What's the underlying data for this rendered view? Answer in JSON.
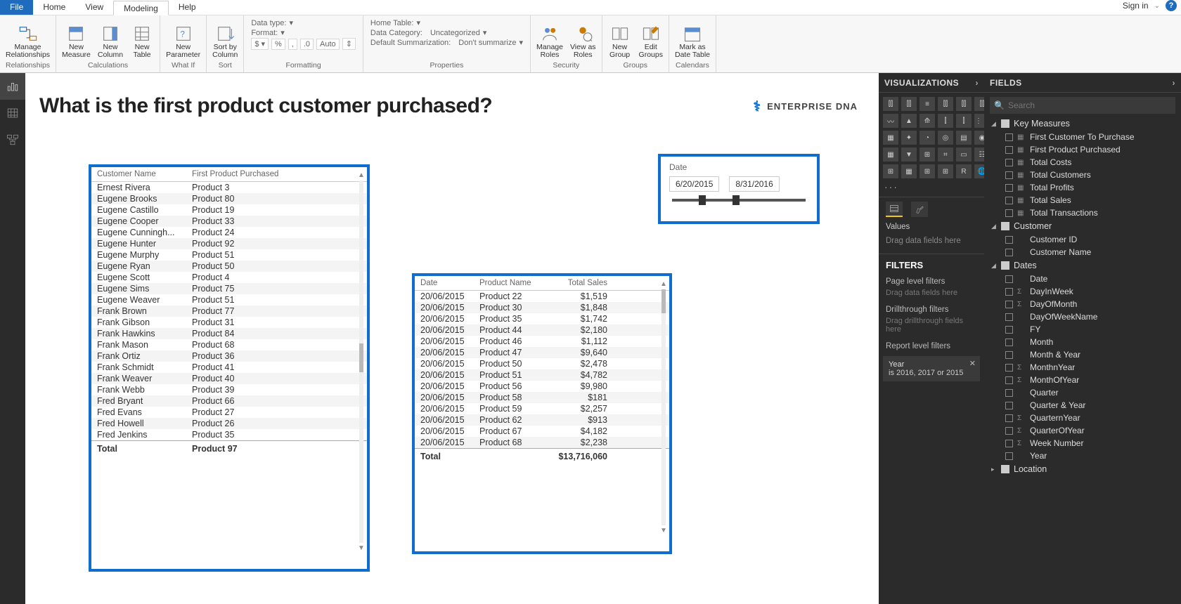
{
  "menu": {
    "file": "File",
    "home": "Home",
    "view": "View",
    "modeling": "Modeling",
    "help": "Help",
    "signin": "Sign in"
  },
  "ribbon": {
    "manageRel": "Manage\nRelationships",
    "relTitle": "Relationships",
    "newMeasure": "New\nMeasure",
    "newColumn": "New\nColumn",
    "newTable": "New\nTable",
    "calcTitle": "Calculations",
    "newParam": "New\nParameter",
    "whatIfTitle": "What If",
    "sort": "Sort by\nColumn",
    "sortTitle": "Sort",
    "dataType": "Data type:",
    "format": "Format:",
    "auto": "Auto",
    "fmtTitle": "Formatting",
    "homeTable": "Home Table:",
    "dataCat": "Data Category:",
    "dataCatVal": "Uncategorized",
    "defSum": "Default Summarization:",
    "defSumVal": "Don't summarize",
    "propsTitle": "Properties",
    "manageRoles": "Manage\nRoles",
    "viewAs": "View as\nRoles",
    "secTitle": "Security",
    "newGroup": "New\nGroup",
    "editGroups": "Edit\nGroups",
    "grpTitle": "Groups",
    "markDate": "Mark as\nDate Table",
    "calTitle": "Calendars"
  },
  "canvas": {
    "title": "What is the first product customer purchased?",
    "brand": "ENTERPRISE DNA"
  },
  "slicer": {
    "label": "Date",
    "from": "6/20/2015",
    "to": "8/31/2016"
  },
  "table1": {
    "h1": "Customer Name",
    "h2": "First Product Purchased",
    "rows": [
      [
        "Ernest Rivera",
        "Product 3"
      ],
      [
        "Eugene Brooks",
        "Product 80"
      ],
      [
        "Eugene Castillo",
        "Product 19"
      ],
      [
        "Eugene Cooper",
        "Product 33"
      ],
      [
        "Eugene Cunningh...",
        "Product 24"
      ],
      [
        "Eugene Hunter",
        "Product 92"
      ],
      [
        "Eugene Murphy",
        "Product 51"
      ],
      [
        "Eugene Ryan",
        "Product 50"
      ],
      [
        "Eugene Scott",
        "Product 4"
      ],
      [
        "Eugene Sims",
        "Product 75"
      ],
      [
        "Eugene Weaver",
        "Product 51"
      ],
      [
        "Frank Brown",
        "Product 77"
      ],
      [
        "Frank Gibson",
        "Product 31"
      ],
      [
        "Frank Hawkins",
        "Product 84"
      ],
      [
        "Frank Mason",
        "Product 68"
      ],
      [
        "Frank Ortiz",
        "Product 36"
      ],
      [
        "Frank Schmidt",
        "Product 41"
      ],
      [
        "Frank Weaver",
        "Product 40"
      ],
      [
        "Frank Webb",
        "Product 39"
      ],
      [
        "Fred Bryant",
        "Product 66"
      ],
      [
        "Fred Evans",
        "Product 27"
      ],
      [
        "Fred Howell",
        "Product 26"
      ],
      [
        "Fred Jenkins",
        "Product 35"
      ]
    ],
    "ft1": "Total",
    "ft2": "Product 97"
  },
  "table2": {
    "h1": "Date",
    "h2": "Product Name",
    "h3": "Total Sales",
    "rows": [
      [
        "20/06/2015",
        "Product 22",
        "$1,519"
      ],
      [
        "20/06/2015",
        "Product 30",
        "$1,848"
      ],
      [
        "20/06/2015",
        "Product 35",
        "$1,742"
      ],
      [
        "20/06/2015",
        "Product 44",
        "$2,180"
      ],
      [
        "20/06/2015",
        "Product 46",
        "$1,112"
      ],
      [
        "20/06/2015",
        "Product 47",
        "$9,640"
      ],
      [
        "20/06/2015",
        "Product 50",
        "$2,478"
      ],
      [
        "20/06/2015",
        "Product 51",
        "$4,782"
      ],
      [
        "20/06/2015",
        "Product 56",
        "$9,980"
      ],
      [
        "20/06/2015",
        "Product 58",
        "$181"
      ],
      [
        "20/06/2015",
        "Product 59",
        "$2,257"
      ],
      [
        "20/06/2015",
        "Product 62",
        "$913"
      ],
      [
        "20/06/2015",
        "Product 67",
        "$4,182"
      ],
      [
        "20/06/2015",
        "Product 68",
        "$2,238"
      ]
    ],
    "ft1": "Total",
    "ft3": "$13,716,060"
  },
  "viz": {
    "title": "VISUALIZATIONS",
    "values": "Values",
    "drag": "Drag data fields here",
    "filters": "FILTERS",
    "pageLevel": "Page level filters",
    "dragHere": "Drag data fields here",
    "drill": "Drillthrough filters",
    "dragDrill": "Drag drillthrough fields here",
    "reportLevel": "Report level filters",
    "chipTitle": "Year",
    "chipVal": "is 2016, 2017 or 2015"
  },
  "fields": {
    "title": "FIELDS",
    "searchPh": "Search",
    "t1": "Key Measures",
    "t1f": [
      "First Customer To Purchase",
      "First Product Purchased",
      "Total Costs",
      "Total Customers",
      "Total Profits",
      "Total Sales",
      "Total Transactions"
    ],
    "t2": "Customer",
    "t2f": [
      "Customer ID",
      "Customer Name"
    ],
    "t3": "Dates",
    "t3f": [
      [
        "Date",
        ""
      ],
      [
        "DayInWeek",
        "Σ"
      ],
      [
        "DayOfMonth",
        "Σ"
      ],
      [
        "DayOfWeekName",
        ""
      ],
      [
        "FY",
        ""
      ],
      [
        "Month",
        ""
      ],
      [
        "Month & Year",
        ""
      ],
      [
        "MonthnYear",
        "Σ"
      ],
      [
        "MonthOfYear",
        "Σ"
      ],
      [
        "Quarter",
        ""
      ],
      [
        "Quarter & Year",
        ""
      ],
      [
        "QuarternYear",
        "Σ"
      ],
      [
        "QuarterOfYear",
        "Σ"
      ],
      [
        "Week Number",
        "Σ"
      ],
      [
        "Year",
        ""
      ]
    ],
    "t4": "Location"
  }
}
